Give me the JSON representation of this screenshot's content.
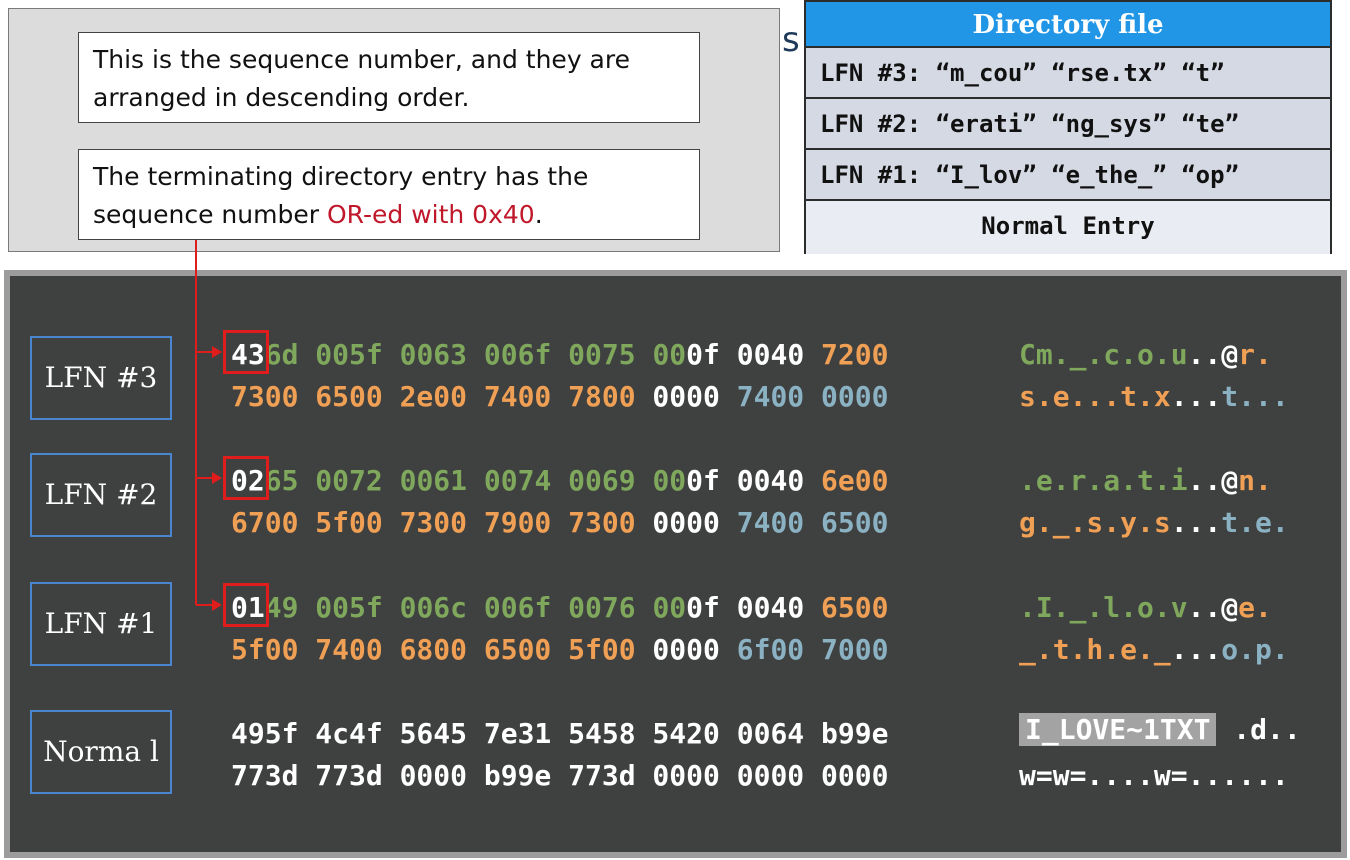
{
  "notes": {
    "note1": "This is the sequence number, and they are arranged in descending order.",
    "note2_prefix": "The terminating directory entry has the sequence number ",
    "note2_highlight": "OR-ed with 0x40",
    "note2_suffix": "."
  },
  "stray_glyph": "s",
  "directory": {
    "title": "Directory file",
    "rows": [
      "LFN #3: “m_cou” “rse.tx” “t”",
      "LFN #2: “erati” “ng_sys” “te”",
      "LFN #1: “I_lov” “e_the_” “op”"
    ],
    "normal": "Normal Entry"
  },
  "entries": [
    {
      "label": "LFN #3",
      "seq": "43",
      "line1_rest": [
        "6d",
        " 005f 0063 006f 0075 00",
        "0f 0040",
        " 7200"
      ],
      "line2": [
        "7300 6500 2e00 7400 7800",
        " 0000",
        " 7400 0000"
      ],
      "ascii1": [
        "Cm._.c.o.u",
        "..@",
        "r."
      ],
      "ascii2": [
        "s.e...t.x",
        "...",
        "t..."
      ]
    },
    {
      "label": "LFN #2",
      "seq": "02",
      "line1_rest": [
        "65",
        " 0072 0061 0074 0069 00",
        "0f 0040",
        " 6e00"
      ],
      "line2": [
        "6700 5f00 7300 7900 7300",
        " 0000",
        " 7400 6500"
      ],
      "ascii1": [
        ".e.r.a.t.i",
        "..@",
        "n."
      ],
      "ascii2": [
        "g._.s.y.s",
        "...",
        "t.e."
      ]
    },
    {
      "label": "LFN #1",
      "seq": "01",
      "line1_rest": [
        "49",
        " 005f 006c 006f 0076 00",
        "0f 0040",
        " 6500"
      ],
      "line2": [
        "5f00 7400 6800 6500 5f00",
        " 0000",
        " 6f00 7000"
      ],
      "ascii1": [
        ".I._.l.o.v",
        "..@",
        "e."
      ],
      "ascii2": [
        "_.t.h.e._",
        "...",
        "o.p."
      ]
    }
  ],
  "normal_entry": {
    "label": "Norma l",
    "line1": "495f 4c4f 5645 7e31 5458 5420 0064 b99e",
    "line2": "773d 773d 0000 b99e 773d 0000 0000 0000",
    "ascii1_name": "I_LOVE~1TXT",
    "ascii1_rest": " .d..",
    "ascii2": "w=w=....w=......"
  },
  "colors": {
    "unicode_green": "#7fa85c",
    "unicode_orange": "#f0a055",
    "attr_white": "#ffffff",
    "blue_gray": "#8bb2c3",
    "highlight_red": "#e01d1d",
    "dir_header_blue": "#2196e6",
    "label_border_blue": "#4a86d0"
  }
}
